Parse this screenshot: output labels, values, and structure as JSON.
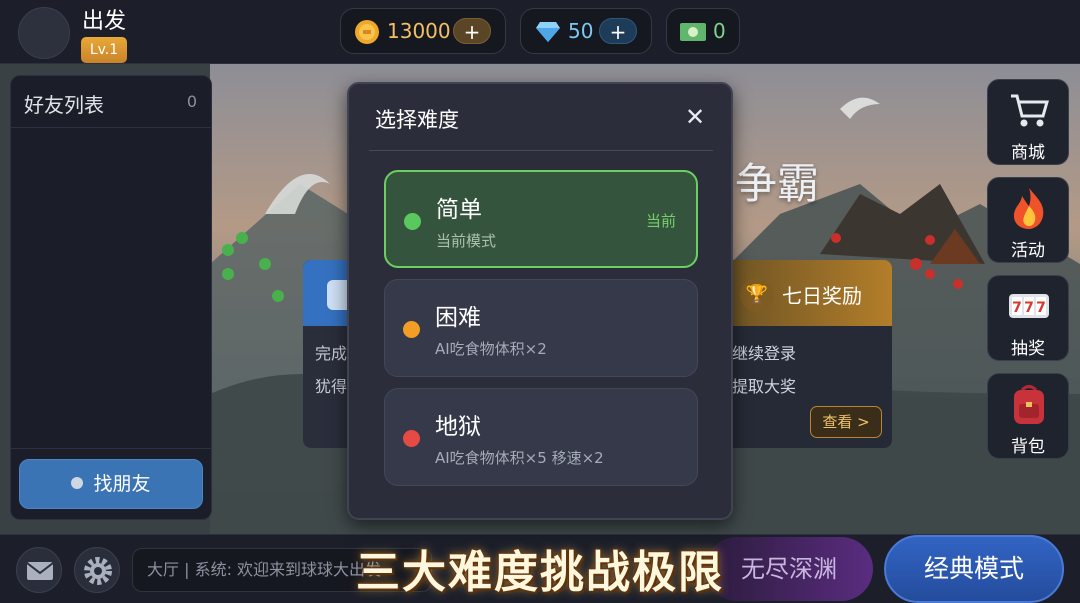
{
  "player": {
    "name": "出发",
    "level": "Lv.1"
  },
  "resources": {
    "coins": "13000",
    "gems": "50",
    "cash": "0",
    "plus": "+"
  },
  "friends": {
    "title": "好友列表",
    "count": "0",
    "find_button": "找朋友"
  },
  "background_title": "争霸",
  "task_card": {
    "line1": "完成",
    "line2": "犹得"
  },
  "reward_card": {
    "title": "七日奖励",
    "line1": "继续登录",
    "line2": "提取大奖",
    "view_button": "查看 >"
  },
  "side_buttons": [
    {
      "label": "商城",
      "icon": "shopping-cart-icon"
    },
    {
      "label": "活动",
      "icon": "flame-icon"
    },
    {
      "label": "抽奖",
      "icon": "slot-machine-icon"
    },
    {
      "label": "背包",
      "icon": "backpack-icon"
    }
  ],
  "bottom": {
    "chat_text": "大厅 | 系统: 欢迎来到球球大出发",
    "mode_endless": "无尽深渊",
    "mode_classic": "经典模式"
  },
  "promo_caption": "三大难度挑战极限",
  "dialog": {
    "title": "选择难度",
    "close_symbol": "✕",
    "options": [
      {
        "name": "简单",
        "desc": "当前模式",
        "tag": "当前",
        "selected": true,
        "dot_color": "#5ac95d"
      },
      {
        "name": "困难",
        "desc": "AI吃食物体积×2",
        "tag": "",
        "selected": false,
        "dot_color": "#f29d25"
      },
      {
        "name": "地狱",
        "desc": "AI吃食物体积×5 移速×2",
        "tag": "",
        "selected": false,
        "dot_color": "#e64a44"
      }
    ]
  },
  "colors": {
    "accent_green": "#6bd05f",
    "classic_blue": "#3264c4",
    "coin_gold": "#f5c064"
  }
}
